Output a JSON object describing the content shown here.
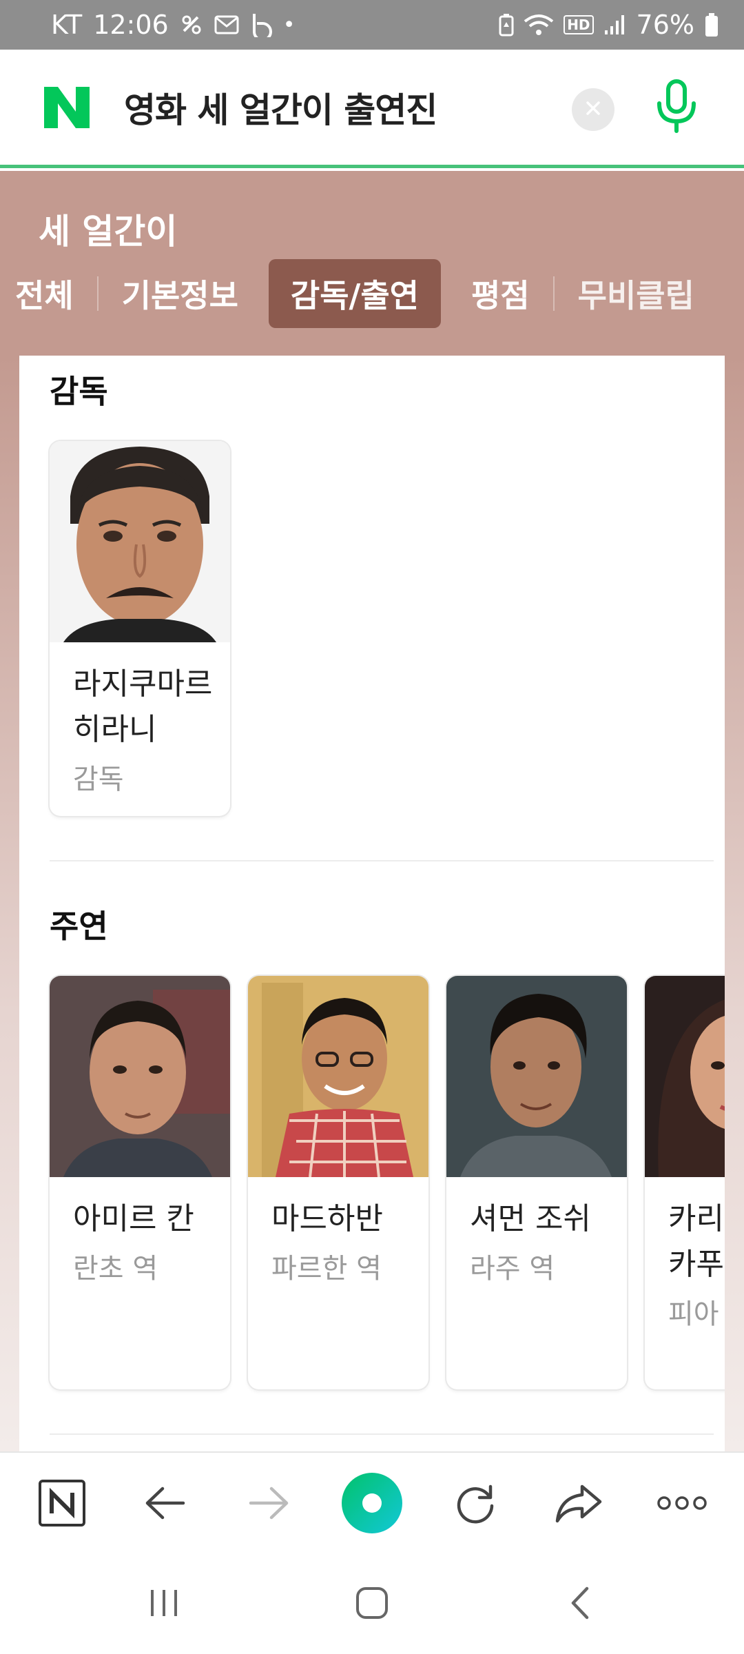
{
  "status_bar": {
    "carrier": "KT",
    "time": "12:06",
    "dot": "•",
    "battery_percent": "76%",
    "network_badge": "HD",
    "icons": [
      "stars-icon",
      "mail-icon",
      "b-app-icon",
      "battery-saver-icon",
      "wifi-icon",
      "signal-icon",
      "battery-icon"
    ]
  },
  "search": {
    "logo": "N",
    "query": "영화 세 얼간이 출연진",
    "clear_icon": "close-icon",
    "mic_icon": "microphone-icon",
    "accent": "#03c75a"
  },
  "movie": {
    "title": "세 얼간이",
    "tabs": [
      {
        "label": "전체",
        "active": false
      },
      {
        "label": "기본정보",
        "active": false
      },
      {
        "label": "감독/출연",
        "active": true
      },
      {
        "label": "평점",
        "active": false
      },
      {
        "label": "무비클립",
        "active": false
      }
    ],
    "band_color": "#c39a90",
    "active_tab_color": "#8c5a4e"
  },
  "sections": [
    {
      "title": "감독",
      "people": [
        {
          "name": "라지쿠마르 히라니",
          "role": "감독"
        }
      ]
    },
    {
      "title": "주연",
      "people": [
        {
          "name": "아미르 칸",
          "role": "란초 역"
        },
        {
          "name": "마드하반",
          "role": "파르한 역"
        },
        {
          "name": "셔먼 조쉬",
          "role": "라주 역"
        },
        {
          "name": "카리나 카푸르",
          "role": "피아 역"
        }
      ]
    }
  ],
  "toolbar": {
    "items": [
      "naver-home-icon",
      "back-arrow-icon",
      "forward-arrow-icon",
      "green-dot-icon",
      "refresh-icon",
      "share-icon",
      "more-icon"
    ]
  },
  "nav": {
    "items": [
      "recent-apps-icon",
      "home-icon",
      "back-icon"
    ]
  }
}
